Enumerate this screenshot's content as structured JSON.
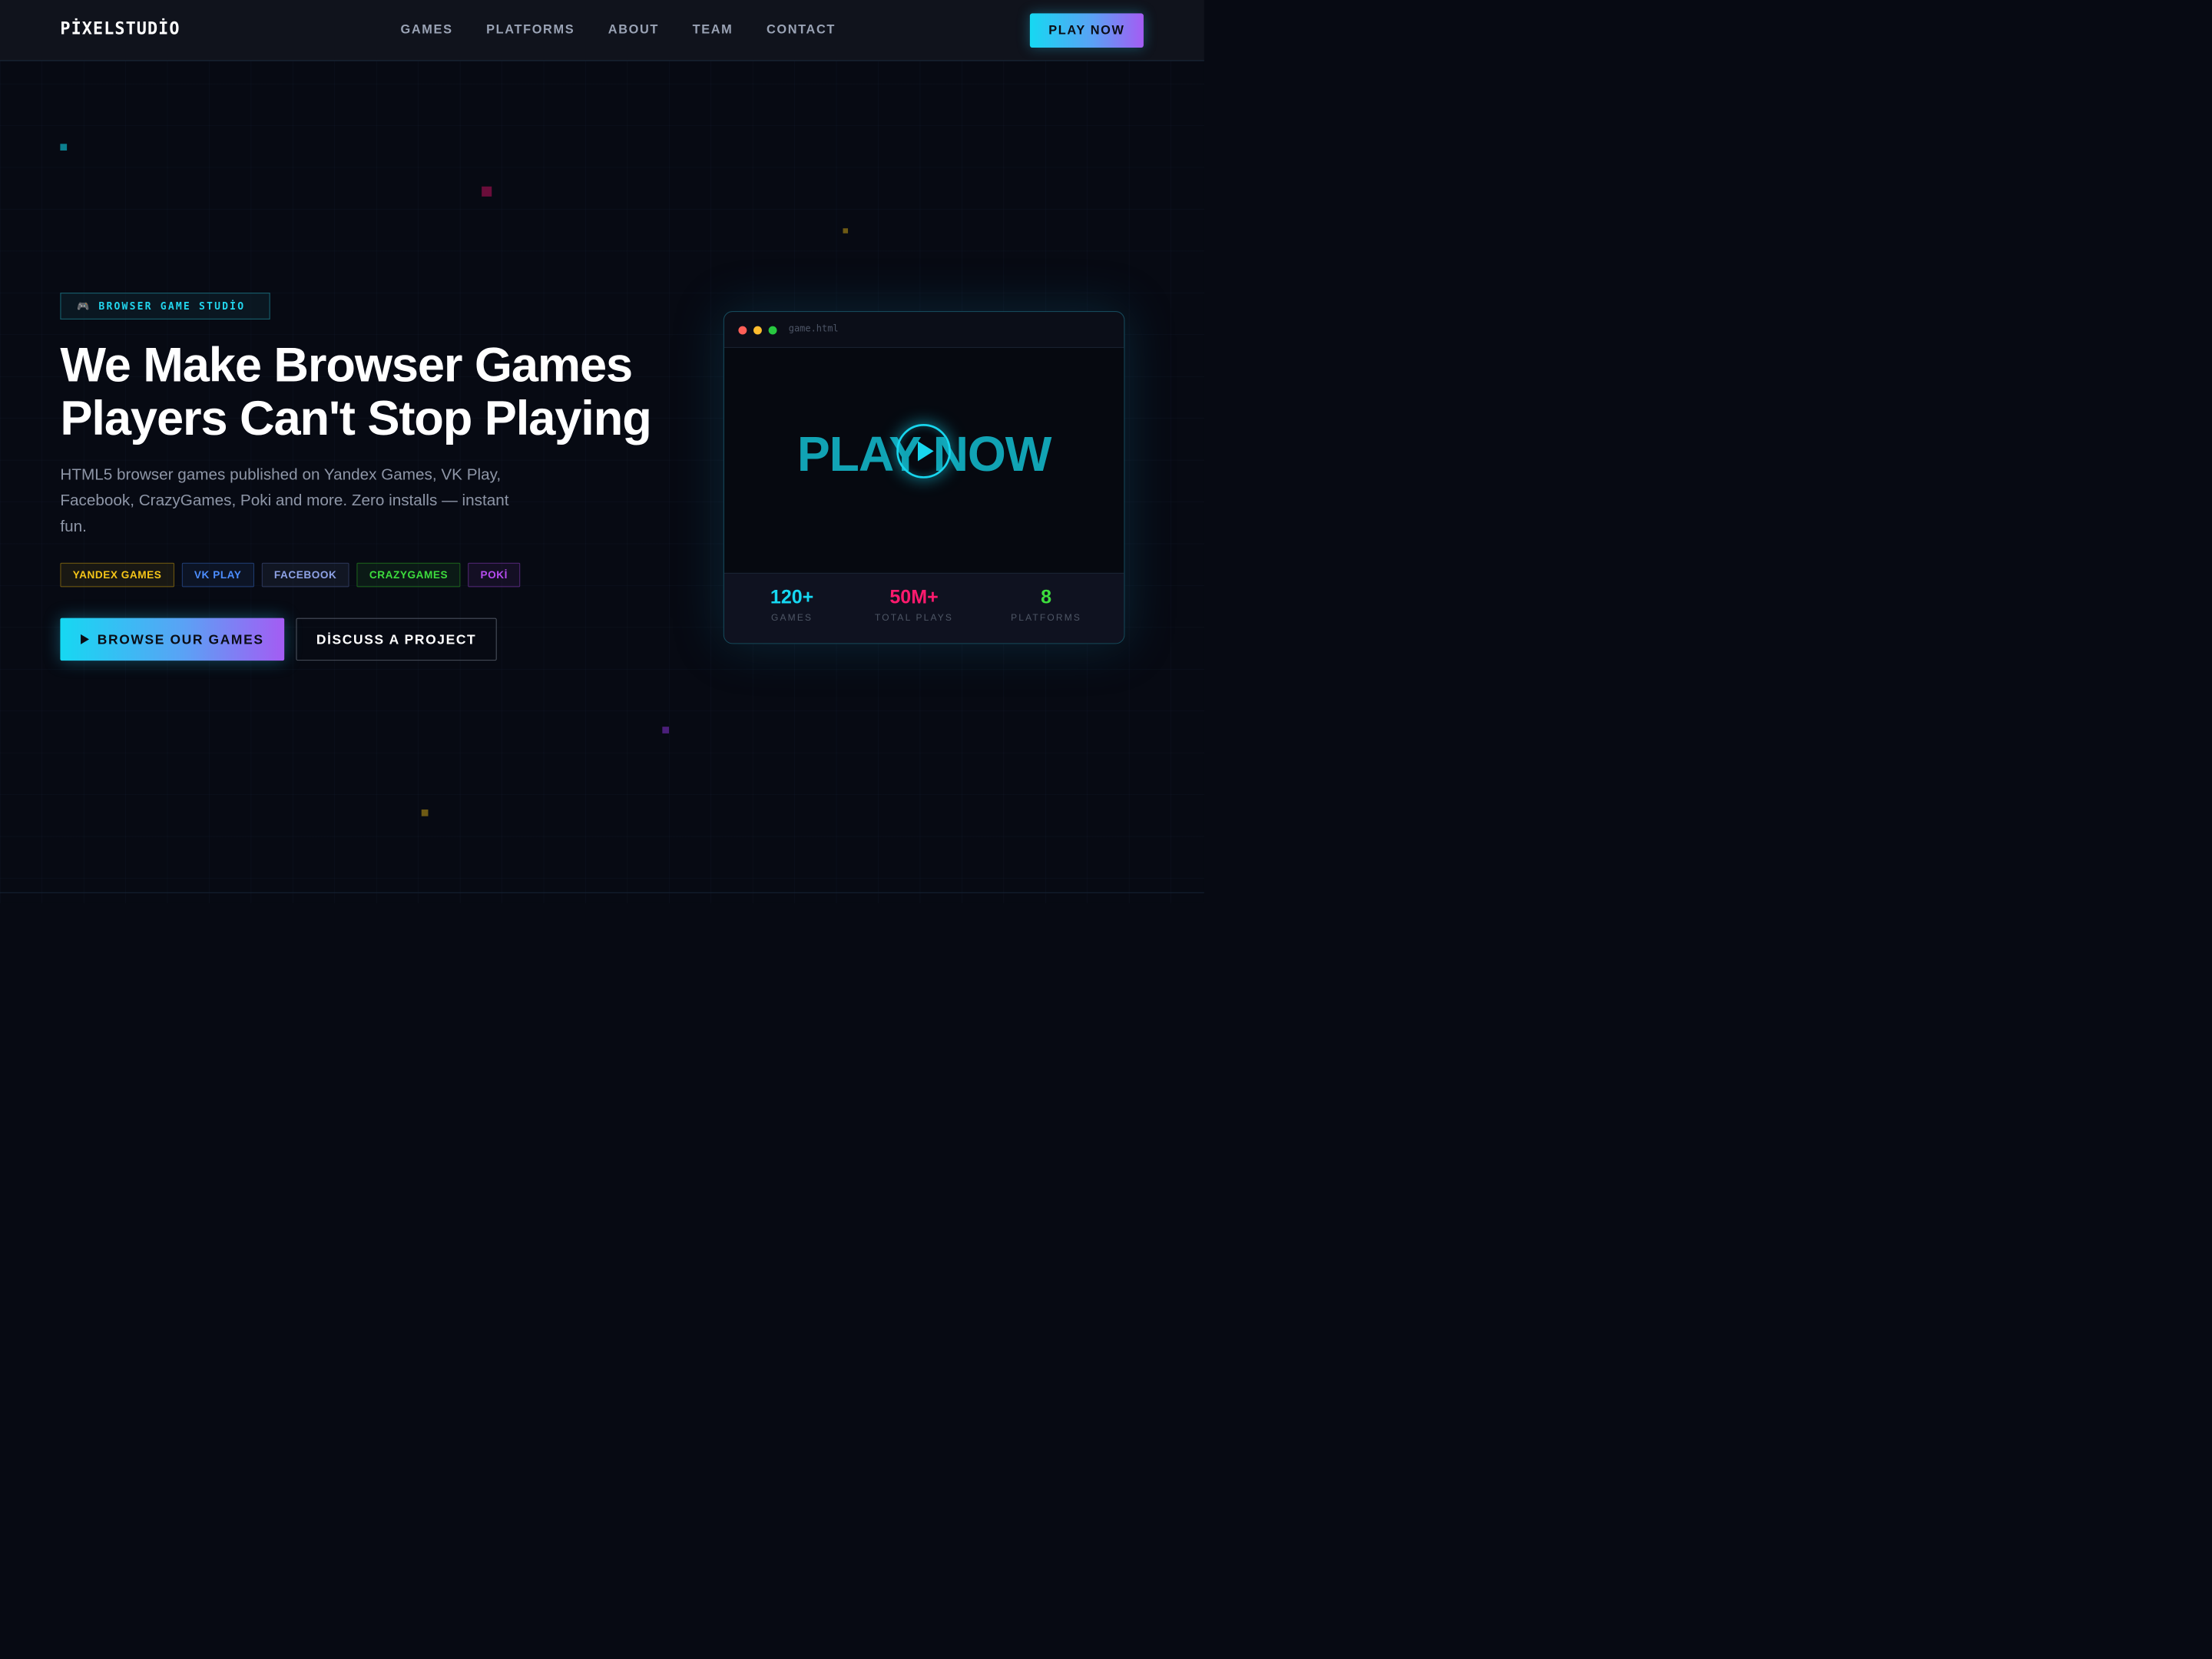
{
  "nav": {
    "logo": "PİXELSTUDİO",
    "links": [
      "GAMES",
      "PLATFORMS",
      "ABOUT",
      "TEAM",
      "CONTACT"
    ],
    "cta": "PLAY NOW"
  },
  "hero": {
    "badge_icon": "gamepad-icon",
    "badge": "BROWSER GAME STUDİO",
    "headline_line1": "We Make Browser Games",
    "headline_line2": "Players Can't Stop Playing",
    "subtitle": "HTML5 browser games published on Yandex Games, VK Play, Facebook, CrazyGames, Poki and more. Zero installs — instant fun.",
    "platforms": [
      "YANDEX GAMES",
      "VK PLAY",
      "FACEBOOK",
      "CRAZYGAMES",
      "POKİ"
    ],
    "platform_colors": [
      "#f5c518",
      "#4c8dff",
      "#8ea2e6",
      "#3ddc3d",
      "#b64cf0"
    ],
    "browse_icon": "play-icon",
    "browse_label": "BROWSE OUR GAMES",
    "discuss_label": "DİSCUSS A PROJECT"
  },
  "game_window": {
    "filename": "game.html",
    "title": "PLAY NOW",
    "play_icon": "play-circle-icon",
    "stats": [
      {
        "value": "120+",
        "label": "GAMES",
        "color": "#16d8f2"
      },
      {
        "value": "50M+",
        "label": "TOTAL PLAYS",
        "color": "#ff1a6e"
      },
      {
        "value": "8",
        "label": "PLATFORMS",
        "color": "#3ddc3d"
      }
    ]
  },
  "colors": {
    "background": "#070a13",
    "accent_cyan": "#16d8f2",
    "accent_purple": "#a45cf3"
  }
}
